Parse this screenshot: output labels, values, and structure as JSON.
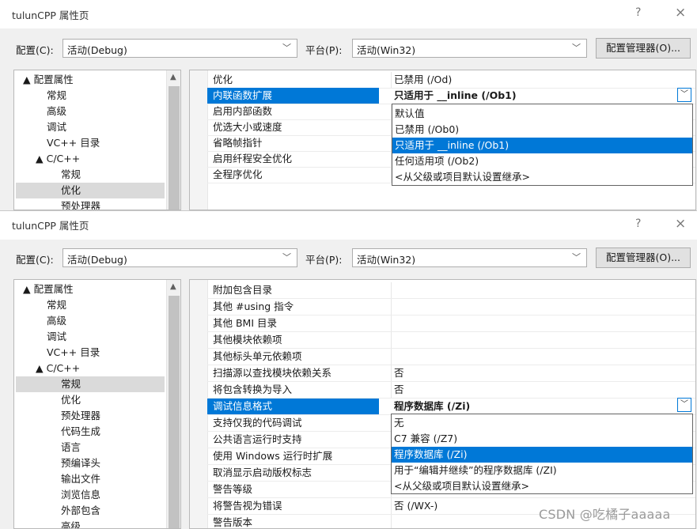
{
  "win1": {
    "title": "tulunCPP 属性页",
    "help": "?",
    "close": "×",
    "config_label": "配置(C):",
    "config_value": "活动(Debug)",
    "platform_label": "平台(P):",
    "platform_value": "活动(Win32)",
    "manager_button": "配置管理器(O)...",
    "tree": [
      "▲ 配置属性",
      "常规",
      "高级",
      "调试",
      "VC++ 目录",
      "▲ C/C++",
      "常规",
      "优化",
      "预处理器"
    ],
    "props": [
      {
        "name": "优化",
        "value": "已禁用 (/Od)"
      },
      {
        "name": "内联函数扩展",
        "value": "只适用于 __inline (/Ob1)"
      },
      {
        "name": "启用内部函数",
        "value": ""
      },
      {
        "name": "优选大小或速度",
        "value": ""
      },
      {
        "name": "省略帧指针",
        "value": ""
      },
      {
        "name": "启用纤程安全优化",
        "value": ""
      },
      {
        "name": "全程序优化",
        "value": ""
      }
    ],
    "options": [
      "默认值",
      "已禁用 (/Ob0)",
      "只适用于 __inline (/Ob1)",
      "任何适用项 (/Ob2)",
      "<从父级或项目默认设置继承>"
    ]
  },
  "win2": {
    "title": "tulunCPP 属性页",
    "help": "?",
    "close": "×",
    "config_label": "配置(C):",
    "config_value": "活动(Debug)",
    "platform_label": "平台(P):",
    "platform_value": "活动(Win32)",
    "manager_button": "配置管理器(O)...",
    "tree": [
      "▲ 配置属性",
      "常规",
      "高级",
      "调试",
      "VC++ 目录",
      "▲ C/C++",
      "常规",
      "优化",
      "预处理器",
      "代码生成",
      "语言",
      "预编译头",
      "输出文件",
      "浏览信息",
      "外部包含",
      "高级"
    ],
    "props": [
      {
        "name": "附加包含目录",
        "value": ""
      },
      {
        "name": "其他 #using 指令",
        "value": ""
      },
      {
        "name": "其他 BMI 目录",
        "value": ""
      },
      {
        "name": "其他模块依赖项",
        "value": ""
      },
      {
        "name": "其他标头单元依赖项",
        "value": ""
      },
      {
        "name": "扫描源以查找模块依赖关系",
        "value": "否"
      },
      {
        "name": "将包含转换为导入",
        "value": "否"
      },
      {
        "name": "调试信息格式",
        "value": "程序数据库 (/Zi)"
      },
      {
        "name": "支持仅我的代码调试",
        "value": ""
      },
      {
        "name": "公共语言运行时支持",
        "value": ""
      },
      {
        "name": "使用 Windows 运行时扩展",
        "value": ""
      },
      {
        "name": "取消显示启动版权标志",
        "value": ""
      },
      {
        "name": "警告等级",
        "value": ""
      },
      {
        "name": "将警告视为错误",
        "value": "否 (/WX-)"
      },
      {
        "name": "警告版本",
        "value": ""
      }
    ],
    "options": [
      "无",
      "C7 兼容 (/Z7)",
      "程序数据库 (/Zi)",
      "用于“编辑并继续”的程序数据库 (/ZI)",
      "<从父级或项目默认设置继承>"
    ]
  },
  "watermark": "CSDN @吃橘子aaaaa",
  "colors": {
    "selection": "#0078d7",
    "window_bg": "#f0f0f0",
    "tree_selected": "#dadada"
  }
}
